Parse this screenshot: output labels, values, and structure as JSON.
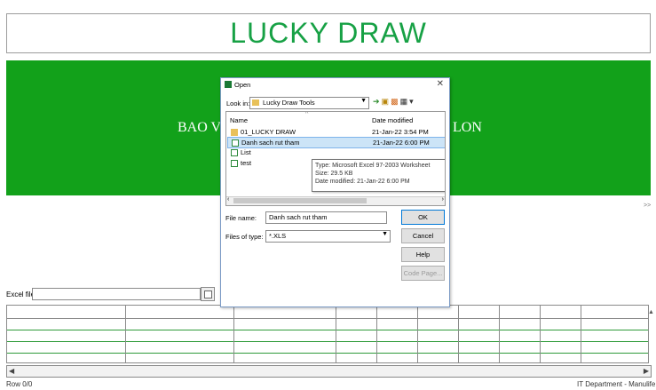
{
  "header": {
    "title": "LUCKY DRAW"
  },
  "banner": {
    "text_left": "BAO V",
    "text_right": "LON"
  },
  "side_link": ">>",
  "excel_file": {
    "label": "Excel file",
    "value": ""
  },
  "status": {
    "row": "Row 0/0",
    "footer": "IT Department - Manulife Viet Nam"
  },
  "dialog": {
    "title": "Open",
    "look_in_label": "Look in:",
    "look_in_value": "Lucky Draw Tools",
    "columns": {
      "name": "Name",
      "date": "Date modified"
    },
    "files": [
      {
        "name": "01_LUCKY DRAW",
        "date": "21-Jan-22 3:54 PM",
        "type": "folder"
      },
      {
        "name": "Danh sach rut tham",
        "date": "21-Jan-22 6:00 PM",
        "type": "xls"
      },
      {
        "name": "List",
        "date": "",
        "type": "xls"
      },
      {
        "name": "test",
        "date": "",
        "type": "xls"
      }
    ],
    "tooltip": {
      "type": "Type: Microsoft Excel 97-2003 Worksheet",
      "size": "Size: 29.5 KB",
      "modified": "Date modified: 21-Jan-22 6:00 PM"
    },
    "file_name_label": "File name:",
    "file_name_value": "Danh sach rut tham",
    "files_of_type_label": "Files of type:",
    "files_of_type_value": "*.XLS",
    "buttons": {
      "ok": "OK",
      "cancel": "Cancel",
      "help": "Help",
      "code_page": "Code Page..."
    }
  },
  "colors": {
    "brand_green": "#12a11a",
    "title_green": "#17a145"
  }
}
